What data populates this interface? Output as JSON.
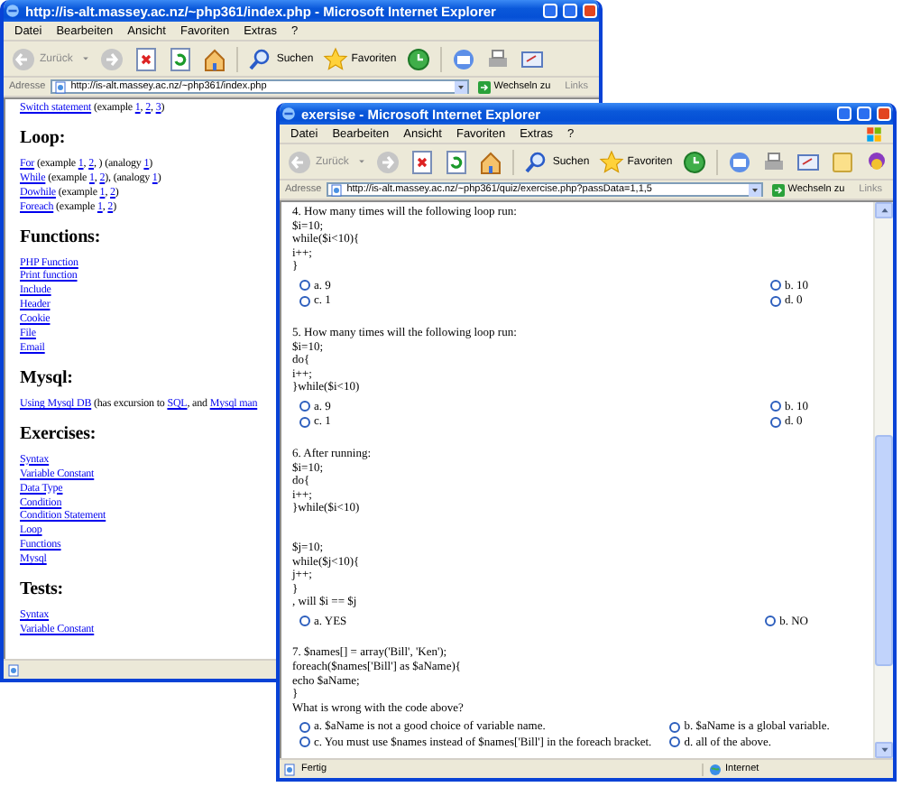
{
  "windows": [
    {
      "title": "http://is-alt.massey.ac.nz/~php361/index.php - Microsoft Internet Explorer",
      "menu": [
        "Datei",
        "Bearbeiten",
        "Ansicht",
        "Favoriten",
        "Extras",
        "?"
      ],
      "toolbar_labels": {
        "back": "Zurück",
        "search": "Suchen",
        "favorites": "Favoriten"
      },
      "address_label": "Adresse",
      "address": "http://is-alt.massey.ac.nz/~php361/index.php",
      "go_label": "Wechseln zu",
      "links_label": "Links",
      "content": [
        {
          "kind": "line",
          "segments": [
            {
              "text": "Switch statement",
              "link": true
            },
            {
              "text": " (example ",
              "link": false
            },
            {
              "text": "1",
              "link": true
            },
            {
              "text": ", ",
              "link": false
            },
            {
              "text": "2",
              "link": true
            },
            {
              "text": ", ",
              "link": false
            },
            {
              "text": "3",
              "link": true
            },
            {
              "text": ")",
              "link": false
            }
          ]
        },
        {
          "kind": "heading",
          "text": "Loop:"
        },
        {
          "kind": "line",
          "segments": [
            {
              "text": "For",
              "link": true
            },
            {
              "text": " (example ",
              "link": false
            },
            {
              "text": "1",
              "link": true
            },
            {
              "text": ", ",
              "link": false
            },
            {
              "text": "2",
              "link": true
            },
            {
              "text": ", ) (analogy ",
              "link": false
            },
            {
              "text": "1",
              "link": true
            },
            {
              "text": ")",
              "link": false
            }
          ]
        },
        {
          "kind": "line",
          "segments": [
            {
              "text": "While",
              "link": true
            },
            {
              "text": " (example ",
              "link": false
            },
            {
              "text": "1",
              "link": true
            },
            {
              "text": ", ",
              "link": false
            },
            {
              "text": "2",
              "link": true
            },
            {
              "text": "), (analogy ",
              "link": false
            },
            {
              "text": "1",
              "link": true
            },
            {
              "text": ")",
              "link": false
            }
          ]
        },
        {
          "kind": "line",
          "segments": [
            {
              "text": "Dowhile",
              "link": true
            },
            {
              "text": " (example ",
              "link": false
            },
            {
              "text": "1",
              "link": true
            },
            {
              "text": ", ",
              "link": false
            },
            {
              "text": "2",
              "link": true
            },
            {
              "text": ")",
              "link": false
            }
          ]
        },
        {
          "kind": "line",
          "segments": [
            {
              "text": "Foreach",
              "link": true
            },
            {
              "text": " (example ",
              "link": false
            },
            {
              "text": "1",
              "link": true
            },
            {
              "text": ", ",
              "link": false
            },
            {
              "text": "2",
              "link": true
            },
            {
              "text": ")",
              "link": false
            }
          ]
        },
        {
          "kind": "heading",
          "text": "Functions:"
        },
        {
          "kind": "line",
          "segments": [
            {
              "text": "PHP Function",
              "link": true
            }
          ]
        },
        {
          "kind": "line",
          "segments": [
            {
              "text": "Print function",
              "link": true
            }
          ]
        },
        {
          "kind": "line",
          "segments": [
            {
              "text": "Include",
              "link": true
            }
          ]
        },
        {
          "kind": "line",
          "segments": [
            {
              "text": "Header",
              "link": true
            }
          ]
        },
        {
          "kind": "line",
          "segments": [
            {
              "text": "Cookie",
              "link": true
            }
          ]
        },
        {
          "kind": "line",
          "segments": [
            {
              "text": "File",
              "link": true
            }
          ]
        },
        {
          "kind": "line",
          "segments": [
            {
              "text": "Email",
              "link": true
            }
          ]
        },
        {
          "kind": "heading",
          "text": "Mysql:"
        },
        {
          "kind": "line",
          "segments": [
            {
              "text": "Using Mysql DB",
              "link": true
            },
            {
              "text": " (has excursion to ",
              "link": false
            },
            {
              "text": "SQL",
              "link": true
            },
            {
              "text": ", and ",
              "link": false
            },
            {
              "text": "Mysql man",
              "link": true
            }
          ]
        },
        {
          "kind": "heading",
          "text": "Exercises:"
        },
        {
          "kind": "line",
          "segments": [
            {
              "text": "Syntax",
              "link": true
            }
          ]
        },
        {
          "kind": "line",
          "segments": [
            {
              "text": "Variable Constant",
              "link": true
            }
          ]
        },
        {
          "kind": "line",
          "segments": [
            {
              "text": "Data Type",
              "link": true
            }
          ]
        },
        {
          "kind": "line",
          "segments": [
            {
              "text": "Condition",
              "link": true
            }
          ]
        },
        {
          "kind": "line",
          "segments": [
            {
              "text": "Condition Statement",
              "link": true
            }
          ]
        },
        {
          "kind": "line",
          "segments": [
            {
              "text": "Loop",
              "link": true
            }
          ]
        },
        {
          "kind": "line",
          "segments": [
            {
              "text": "Functions",
              "link": true
            }
          ]
        },
        {
          "kind": "line",
          "segments": [
            {
              "text": "Mysql",
              "link": true
            }
          ]
        },
        {
          "kind": "heading",
          "text": "Tests:"
        },
        {
          "kind": "line",
          "segments": [
            {
              "text": "Syntax",
              "link": true
            }
          ]
        },
        {
          "kind": "line",
          "segments": [
            {
              "text": "Variable Constant",
              "link": true
            }
          ]
        }
      ]
    },
    {
      "title": "exersise - Microsoft Internet Explorer",
      "menu": [
        "Datei",
        "Bearbeiten",
        "Ansicht",
        "Favoriten",
        "Extras",
        "?"
      ],
      "toolbar_labels": {
        "back": "Zurück",
        "search": "Suchen",
        "favorites": "Favoriten"
      },
      "address_label": "Adresse",
      "address": "http://is-alt.massey.ac.nz/~php361/quiz/exercise.php?passData=1,1,5",
      "go_label": "Wechseln zu",
      "links_label": "Links",
      "content": [
        {
          "kind": "question",
          "paragraphs": [
            [
              "4. How many times will the following loop run:",
              "$i=10;",
              "while($i<10){",
              "i++;",
              "}"
            ]
          ],
          "options": [
            {
              "label": "a. 9",
              "selected": false
            },
            {
              "label": "b. 10",
              "selected": false
            },
            {
              "label": "c. 1",
              "selected": false
            },
            {
              "label": "d. 0",
              "selected": false
            }
          ]
        },
        {
          "kind": "question",
          "paragraphs": [
            [
              "5. How many times will the following loop run:",
              "$i=10;",
              "do{",
              "i++;",
              "}while($i<10)"
            ]
          ],
          "options": [
            {
              "label": "a. 9",
              "selected": false
            },
            {
              "label": "b. 10",
              "selected": false
            },
            {
              "label": "c. 1",
              "selected": false
            },
            {
              "label": "d. 0",
              "selected": false
            }
          ]
        },
        {
          "kind": "question",
          "paragraphs": [
            [
              "6. After running:",
              "$i=10;",
              "do{",
              "i++;",
              "}while($i<10)"
            ],
            [
              "$j=10;",
              "while($j<10){",
              "j++;",
              "}",
              ", will $i == $j"
            ]
          ],
          "options": [
            {
              "label": "a. YES",
              "selected": false
            },
            {
              "label": "b. NO",
              "selected": false
            }
          ]
        },
        {
          "kind": "question",
          "paragraphs": [
            [
              "7. $names[] = array('Bill', 'Ken');",
              "foreach($names['Bill'] as $aName){",
              "echo $aName;",
              "}",
              "What is wrong with the code above?"
            ]
          ],
          "options": [
            {
              "label": "a. $aName is not a good choice of variable name.",
              "selected": false
            },
            {
              "label": "b. $aName is a global variable.",
              "selected": false
            },
            {
              "label": "c. You must use $names instead of $names['Bill'] in the foreach bracket.",
              "selected": false
            },
            {
              "label": "d. all of the above.",
              "selected": false
            }
          ]
        }
      ],
      "status": {
        "text": "Fertig",
        "zone": "Internet"
      }
    }
  ]
}
